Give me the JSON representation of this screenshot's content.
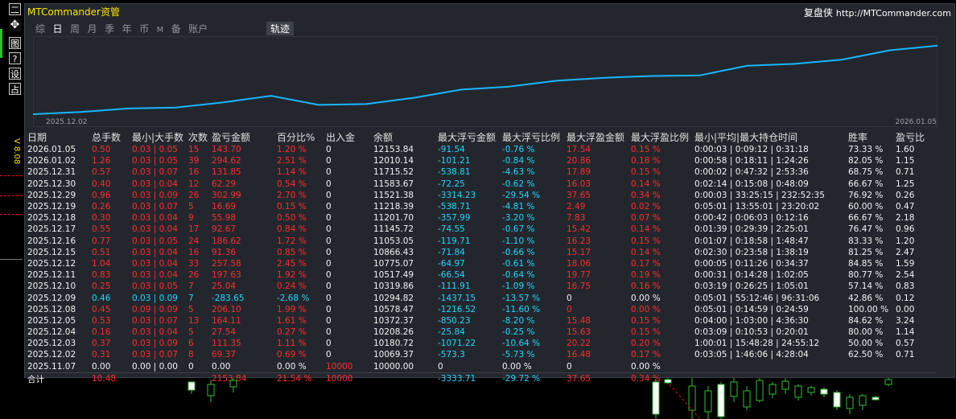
{
  "toolbar": {
    "buttons": [
      {
        "name": "minimize",
        "glyph": "二"
      },
      {
        "name": "move",
        "glyph": "✥"
      },
      {
        "name": "record",
        "glyph": "图"
      },
      {
        "name": "help",
        "glyph": "?"
      },
      {
        "name": "settings",
        "glyph": "设"
      },
      {
        "name": "reset",
        "glyph": "占"
      }
    ],
    "version": "V 8.08"
  },
  "panel": {
    "title": "MTCommander资管",
    "brand": "复盘侠",
    "url": "http://MTCommander.com"
  },
  "tabs": [
    {
      "label": "综",
      "active": false
    },
    {
      "label": "日",
      "active": true
    },
    {
      "label": "周",
      "active": false
    },
    {
      "label": "月",
      "active": false
    },
    {
      "label": "季",
      "active": false
    },
    {
      "label": "年",
      "active": false
    },
    {
      "label": "币",
      "active": false
    },
    {
      "label": "M",
      "active": false
    },
    {
      "label": "备",
      "active": false
    },
    {
      "label": "账户",
      "active": false
    }
  ],
  "trajectory_tab": "轨迹",
  "chart_data": {
    "type": "line",
    "x_start_label": "2025.12.02",
    "x_end_label": "2026.01.05",
    "x": [
      "2025.11.07",
      "2025.12.02",
      "2025.12.03",
      "2025.12.04",
      "2025.12.05",
      "2025.12.08",
      "2025.12.09",
      "2025.12.10",
      "2025.12.11",
      "2025.12.12",
      "2025.12.15",
      "2025.12.16",
      "2025.12.17",
      "2025.12.18",
      "2025.12.19",
      "2025.12.25",
      "2025.12.29",
      "2025.12.30",
      "2025.12.31",
      "2026.01.02",
      "2026.01.05"
    ],
    "values": [
      10000.0,
      10069.37,
      10180.72,
      10208.26,
      10372.37,
      10578.47,
      10294.82,
      10319.86,
      10517.49,
      10775.07,
      10866.43,
      11053.05,
      11145.72,
      11201.7,
      11218.39,
      11521.38,
      11583.67,
      11715.52,
      12010.14,
      12153.84
    ],
    "series_color": "#19b6ff"
  },
  "table": {
    "headers": [
      "日期",
      "总手数",
      "最小|大手数",
      "次数",
      "盈亏金额",
      "百分比%",
      "出入金",
      "余额",
      "最大浮亏金额",
      "最大浮亏比例",
      "最大浮盈金额",
      "最大浮盈比例",
      "最小|平均|最大持仓时间",
      "胜率",
      "盈亏比"
    ],
    "rows": [
      {
        "cells": [
          "2026.01.05",
          "0.50",
          "0.03 | 0.05",
          "15",
          "143.70",
          "1.20 %",
          "0",
          "12153.84",
          "-91.54",
          "-0.76 %",
          "17.54",
          "0.15 %",
          "0:00:03 | 0:09:12 | 0:31:18",
          "73.33 %",
          "1.60"
        ],
        "tone": "red"
      },
      {
        "cells": [
          "2026.01.02",
          "1.26",
          "0.03 | 0.05",
          "39",
          "294.62",
          "2.51 %",
          "0",
          "12010.14",
          "-101.21",
          "-0.84 %",
          "20.86",
          "0.18 %",
          "0:00:58 | 0:18:11 | 1:24:26",
          "82.05 %",
          "1.15"
        ],
        "tone": "red"
      },
      {
        "cells": [
          "2025.12.31",
          "0.57",
          "0.03 | 0.07",
          "16",
          "131.85",
          "1.14 %",
          "0",
          "11715.52",
          "-538.81",
          "-4.63 %",
          "17.89",
          "0.15 %",
          "0:00:02 | 0:47:32 | 2:53:36",
          "68.75 %",
          "0.71"
        ],
        "tone": "red"
      },
      {
        "cells": [
          "2025.12.30",
          "0.40",
          "0.03 | 0.04",
          "12",
          "62.29",
          "0.54 %",
          "0",
          "11583.67",
          "-72.25",
          "-0.62 %",
          "16.03",
          "0.14 %",
          "0:02:14 | 0:15:08 | 0:48:09",
          "66.67 %",
          "1.25"
        ],
        "tone": "red"
      },
      {
        "cells": [
          "2025.12.29",
          "0.96",
          "0.03 | 0.09",
          "26",
          "302.99",
          "2.70 %",
          "0",
          "11521.38",
          "-3314.23",
          "-29.54 %",
          "37.65",
          "0.34 %",
          "0:00:03 | 33:25:15 | 232:52:35",
          "76.92 %",
          "0.26"
        ],
        "tone": "red"
      },
      {
        "cells": [
          "2025.12.19",
          "0.26",
          "0.03 | 0.07",
          "5",
          "16.69",
          "0.15 %",
          "0",
          "11218.39",
          "-538.71",
          "-4.81 %",
          "2.49",
          "0.02 %",
          "0:05:01 | 13:55:01 | 23:20:02",
          "60.00 %",
          "0.47"
        ],
        "tone": "red"
      },
      {
        "cells": [
          "2025.12.18",
          "0.30",
          "0.03 | 0.04",
          "9",
          "55.98",
          "0.50 %",
          "0",
          "11201.70",
          "-357.99",
          "-3.20 %",
          "7.83",
          "0.07 %",
          "0:00:42 | 0:06:03 | 0:12:16",
          "66.67 %",
          "2.18"
        ],
        "tone": "red"
      },
      {
        "cells": [
          "2025.12.17",
          "0.55",
          "0.03 | 0.04",
          "17",
          "92.67",
          "0.84 %",
          "0",
          "11145.72",
          "-74.55",
          "-0.67 %",
          "15.42",
          "0.14 %",
          "0:01:39 | 0:29:39 | 2:25:01",
          "76.47 %",
          "0.96"
        ],
        "tone": "red"
      },
      {
        "cells": [
          "2025.12.16",
          "0.77",
          "0.03 | 0.05",
          "24",
          "186.62",
          "1.72 %",
          "0",
          "11053.05",
          "-119.71",
          "-1.10 %",
          "16.23",
          "0.15 %",
          "0:01:07 | 0:18:58 | 1:48:47",
          "83.33 %",
          "1.20"
        ],
        "tone": "red"
      },
      {
        "cells": [
          "2025.12.15",
          "0.51",
          "0.03 | 0.04",
          "16",
          "91.36",
          "0.85 %",
          "0",
          "10866.43",
          "-71.84",
          "-0.66 %",
          "15.17",
          "0.14 %",
          "0:02:30 | 0:23:58 | 1:38:19",
          "81.25 %",
          "2.47"
        ],
        "tone": "red"
      },
      {
        "cells": [
          "2025.12.12",
          "1.04",
          "0.03 | 0.04",
          "33",
          "257.58",
          "2.45 %",
          "0",
          "10775.07",
          "-64.97",
          "-0.61 %",
          "18.06",
          "0.17 %",
          "0:00:05 | 0:11:26 | 0:34:37",
          "84.85 %",
          "1.59"
        ],
        "tone": "red"
      },
      {
        "cells": [
          "2025.12.11",
          "0.83",
          "0.03 | 0.04",
          "26",
          "197.63",
          "1.92 %",
          "0",
          "10517.49",
          "-66.54",
          "-0.64 %",
          "19.77",
          "0.19 %",
          "0:00:31 | 0:14:28 | 1:02:05",
          "80.77 %",
          "2.54"
        ],
        "tone": "red"
      },
      {
        "cells": [
          "2025.12.10",
          "0.25",
          "0.03 | 0.05",
          "7",
          "25.04",
          "0.24 %",
          "0",
          "10319.86",
          "-111.91",
          "-1.09 %",
          "16.75",
          "0.16 %",
          "0:03:19 | 0:26:25 | 1:05:01",
          "57.14 %",
          "0.83"
        ],
        "tone": "red"
      },
      {
        "cells": [
          "2025.12.09",
          "0.46",
          "0.03 | 0.09",
          "7",
          "-283.65",
          "-2.68 %",
          "0",
          "10294.82",
          "-1437.15",
          "-13.57 %",
          "0",
          "0.00 %",
          "0:05:01 | 55:12:46 | 96:31:06",
          "42.86 %",
          "0.12"
        ],
        "tone": "cyan"
      },
      {
        "cells": [
          "2025.12.08",
          "0.45",
          "0.09 | 0.09",
          "5",
          "206.10",
          "1.99 %",
          "0",
          "10578.47",
          "-1216.52",
          "-11.60 %",
          "0",
          "0.00 %",
          "0:05:01 | 0:14:59 | 0:24:59",
          "100.00 %",
          "0.00"
        ],
        "tone": "red"
      },
      {
        "cells": [
          "2025.12.05",
          "0.53",
          "0.03 | 0.07",
          "13",
          "164.11",
          "1.61 %",
          "0",
          "10372.37",
          "-850.23",
          "-8.20 %",
          "15.48",
          "0.15 %",
          "0:04:00 | 1:03:00 | 4:36:30",
          "84.62 %",
          "3.24"
        ],
        "tone": "red"
      },
      {
        "cells": [
          "2025.12.04",
          "0.16",
          "0.03 | 0.04",
          "5",
          "27.54",
          "0.27 %",
          "0",
          "10208.26",
          "-25.84",
          "-0.25 %",
          "15.63",
          "0.15 %",
          "0:03:09 | 0:10:53 | 0:20:01",
          "80.00 %",
          "1.14"
        ],
        "tone": "red"
      },
      {
        "cells": [
          "2025.12.03",
          "0.37",
          "0.03 | 0.09",
          "6",
          "111.35",
          "1.11 %",
          "0",
          "10180.72",
          "-1071.22",
          "-10.64 %",
          "20.22",
          "0.20 %",
          "1:00:01 | 15:48:28 | 24:55:12",
          "50.00 %",
          "0.57"
        ],
        "tone": "red"
      },
      {
        "cells": [
          "2025.12.02",
          "0.31",
          "0.03 | 0.07",
          "8",
          "69.37",
          "0.69 %",
          "0",
          "10069.37",
          "-573.3",
          "-5.73 %",
          "16.48",
          "0.17 %",
          "0:03:05 | 1:46:06 | 4:28:04",
          "62.50 %",
          "0.71"
        ],
        "tone": "red"
      },
      {
        "cells": [
          "2025.11.07",
          "0.00",
          "0.00 | 0.00",
          "0",
          "0.00",
          "0.00 %",
          "10000",
          "10000.00",
          "0",
          "0.00 %",
          "0",
          "0.00 %",
          "",
          "",
          ""
        ],
        "tone": "white"
      }
    ],
    "total": [
      "合计",
      "10.48",
      "",
      "",
      "2153.84",
      "21.54 %",
      "10000",
      "",
      "-3333.71",
      "-29.72 %",
      "37.65",
      "0.34 %",
      "",
      "",
      ""
    ]
  },
  "colors": {
    "panel_bg": "#23272d",
    "profit": "#ff2b2b",
    "loss": "#1fd7ff",
    "title": "#ffe600",
    "curve": "#19b6ff"
  }
}
